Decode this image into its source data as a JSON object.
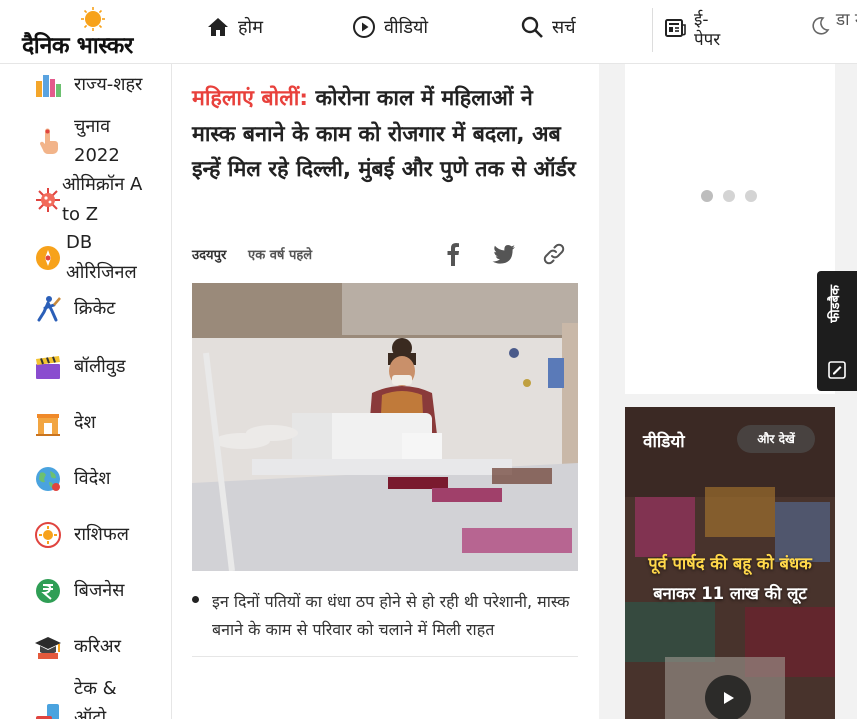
{
  "header": {
    "logo_text": "दैनिक भास्कर",
    "nav": [
      {
        "label": "होम",
        "icon": "home-icon"
      },
      {
        "label": "वीडियो",
        "icon": "play-circle-icon"
      },
      {
        "label": "सर्च",
        "icon": "search-icon"
      }
    ],
    "epaper_label": "ई-पेपर",
    "dark_mode_label": "डा मो"
  },
  "sidebar": {
    "items": [
      {
        "label": "राज्य-शहर",
        "icon": "city-icon"
      },
      {
        "label": "चुनाव 2022",
        "icon": "voting-finger-icon"
      },
      {
        "label": "ओमिक्रॉन A to Z",
        "icon": "virus-icon"
      },
      {
        "label": "DB ओरिजिनल",
        "icon": "db-original-icon"
      },
      {
        "label": "क्रिकेट",
        "icon": "cricket-icon"
      },
      {
        "label": "बॉलीवुड",
        "icon": "clapperboard-icon"
      },
      {
        "label": "देश",
        "icon": "india-gate-icon"
      },
      {
        "label": "विदेश",
        "icon": "globe-icon"
      },
      {
        "label": "राशिफल",
        "icon": "zodiac-icon"
      },
      {
        "label": "बिजनेस",
        "icon": "rupee-icon"
      },
      {
        "label": "करिअर",
        "icon": "graduation-cap-icon"
      },
      {
        "label": "टेक & ऑटो",
        "icon": "tech-auto-icon"
      }
    ]
  },
  "article": {
    "kicker": "महिलाएं बोलीं:",
    "headline": "कोरोना काल में महिलाओं ने मास्क बनाने के काम को रोजगार में बदला, अब इन्हें मिल रहे दिल्ली, मुंबई और पुणे तक से ऑर्डर",
    "city": "उदयपुर",
    "time_ago": "एक वर्ष पहले",
    "bullet": "इन दिनों पतियों का धंधा ठप होने से हो रही थी परेशानी, मास्क बनाने के काम से परिवार को चलाने में मिली राहत"
  },
  "right": {
    "feedback_label": "फीडबैक",
    "video_card": {
      "title": "वीडियो",
      "more_label": "और देखें",
      "caption_highlight": "पूर्व पार्षद की बहू को बंधक",
      "caption_rest": "बनाकर 11 लाख की लूट"
    }
  },
  "colors": {
    "kicker": "#e8413c",
    "brand_sun": "#f7a21b",
    "caption_highlight": "#ffd84a"
  }
}
